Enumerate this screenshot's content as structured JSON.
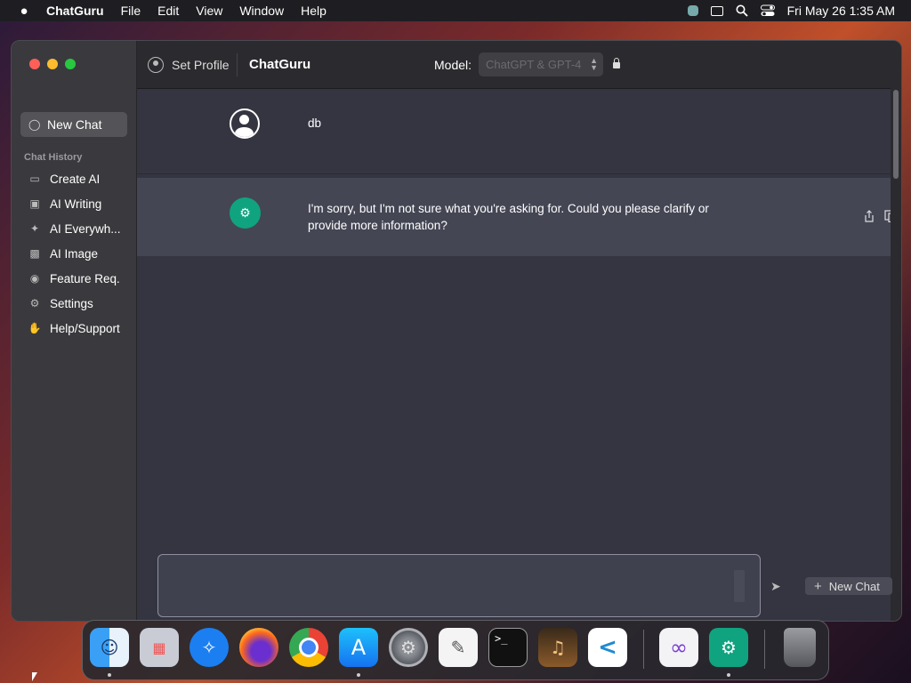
{
  "menubar": {
    "apple": "",
    "items": [
      "ChatGuru",
      "File",
      "Edit",
      "View",
      "Window",
      "Help"
    ],
    "clock": "Fri May 26  1:35 AM"
  },
  "sidebar": {
    "new_chat": "New Chat",
    "history_label": "Chat History",
    "items": [
      {
        "label": "Create AI",
        "icon": "document-icon"
      },
      {
        "label": "AI Writing",
        "icon": "laptop-icon"
      },
      {
        "label": "AI Everywh...",
        "icon": "sparkle-icon"
      },
      {
        "label": "AI Image",
        "icon": "image-icon"
      },
      {
        "label": "Feature Req.",
        "icon": "person-circle-icon"
      },
      {
        "label": "Settings",
        "icon": "gear-icon"
      },
      {
        "label": "Help/Support",
        "icon": "hand-icon"
      }
    ]
  },
  "header": {
    "profile_label": "Set Profile",
    "title": "ChatGuru",
    "model_label": "Model:",
    "model_value": "ChatGPT & GPT-4"
  },
  "chat": {
    "messages": [
      {
        "role": "user",
        "text": "db"
      },
      {
        "role": "assistant",
        "text": "I'm sorry, but I'm not sure what you're asking for. Could you please clarify or provide more information?"
      }
    ]
  },
  "composer": {
    "input_value": "",
    "new_chat_label": "New Chat"
  },
  "dock": {
    "apps": [
      "Finder",
      "Launchpad",
      "Safari",
      "Firefox",
      "Chrome",
      "App Store",
      "System Settings",
      "TextEdit",
      "Terminal",
      "GarageBand",
      "VS Code",
      "Visual Studio",
      "ChatGuru",
      "Trash"
    ]
  },
  "colors": {
    "accent_green": "#10a37f",
    "window_bg": "#343541",
    "bot_row_bg": "#444654"
  }
}
